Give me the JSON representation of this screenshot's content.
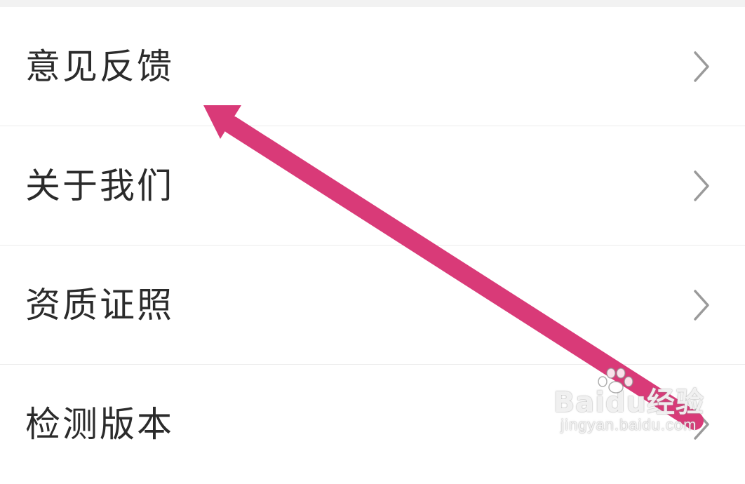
{
  "menu": {
    "items": [
      {
        "label": "意见反馈",
        "icon": "chevron-right-icon"
      },
      {
        "label": "关于我们",
        "icon": "chevron-right-icon"
      },
      {
        "label": "资质证照",
        "icon": "chevron-right-icon"
      },
      {
        "label": "检测版本",
        "icon": "chevron-right-icon"
      }
    ]
  },
  "annotation": {
    "arrow_color": "#d93a78"
  },
  "watermark": {
    "brand": "Baidu经验",
    "url": "jingyan.baidu.com"
  },
  "colors": {
    "background": "#ffffff",
    "divider": "#ececec",
    "text": "#2b2b2b",
    "chevron": "#9a9a9a"
  }
}
